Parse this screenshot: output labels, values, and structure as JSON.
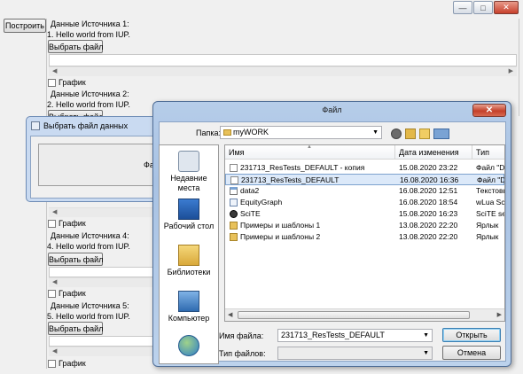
{
  "main_window": {
    "build_button": "Построить",
    "sources": [
      {
        "heading": "Данные Источника 1:",
        "line": "1. Hello world from IUP.",
        "choose": "Выбрать файл",
        "chart": "График"
      },
      {
        "heading": "Данные Источника 2:",
        "line": "2. Hello world from IUP.",
        "choose": "Выбрать файл",
        "chart": "График"
      },
      {
        "heading": "Данные Источника 4:",
        "line": "4. Hello world from IUP.",
        "choose": "Выбрать файл",
        "chart": "График"
      },
      {
        "heading": "Данные Источника 5:",
        "line": "5. Hello world from IUP.",
        "choose": "Выбрать файл",
        "chart": "График"
      }
    ],
    "window_buttons": {
      "minimize": "—",
      "maximize": "□",
      "close": "✕"
    }
  },
  "small_dialog": {
    "title": "Выбрать файл данных",
    "partial_text": "Фа"
  },
  "file_dialog": {
    "title": "Файл",
    "close": "✕",
    "folder_label": "Папка:",
    "folder_value": "myWORK",
    "places": [
      {
        "label": "Недавние места",
        "icon": "recent-places-icon"
      },
      {
        "label": "Рабочий стол",
        "icon": "desktop-icon"
      },
      {
        "label": "Библиотеки",
        "icon": "libraries-icon"
      },
      {
        "label": "Компьютер",
        "icon": "computer-icon"
      },
      {
        "label": "",
        "icon": "network-icon"
      }
    ],
    "columns": [
      "Имя",
      "Дата изменения",
      "Тип"
    ],
    "files": [
      {
        "name": "231713_ResTests_DEFAULT - копия",
        "date": "15.08.2020 23:22",
        "type": "Файл \"DA",
        "icon": "file-icon"
      },
      {
        "name": "231713_ResTests_DEFAULT",
        "date": "16.08.2020 16:36",
        "type": "Файл \"DA",
        "icon": "file-icon",
        "selected": true
      },
      {
        "name": "data2",
        "date": "16.08.2020 12:51",
        "type": "Текстовы",
        "icon": "text-file-icon"
      },
      {
        "name": "EquityGraph",
        "date": "16.08.2020 18:54",
        "type": "wLua Scrip",
        "icon": "lua-file-icon"
      },
      {
        "name": "SciTE",
        "date": "15.08.2020 16:23",
        "type": "SciTE sess",
        "icon": "scite-icon"
      },
      {
        "name": "Примеры и шаблоны 1",
        "date": "13.08.2020 22:20",
        "type": "Ярлык",
        "icon": "shortcut-icon"
      },
      {
        "name": "Примеры и шаблоны 2",
        "date": "13.08.2020 22:20",
        "type": "Ярлык",
        "icon": "shortcut-icon"
      }
    ],
    "filename_label": "Имя файла:",
    "filename_value": "231713_ResTests_DEFAULT",
    "filetype_label": "Тип файлов:",
    "filetype_value": "",
    "open_button": "Открыть",
    "cancel_button": "Отмена"
  }
}
